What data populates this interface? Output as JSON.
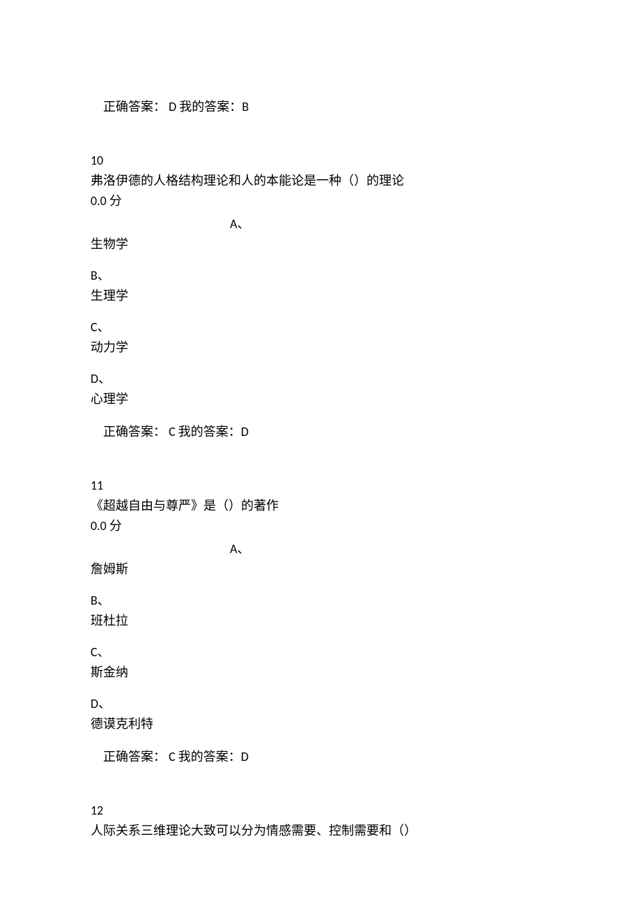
{
  "q9_answer": {
    "correct_label": "正确答案：",
    "correct_value": " D ",
    "my_label": "  我的答案：",
    "my_value": "B"
  },
  "q10": {
    "number": "10",
    "stem": "弗洛伊德的人格结构理论和人的本能论是一种（）的理论",
    "score": "0.0 分",
    "opts": {
      "a_label": "A、",
      "a_text": "生物学",
      "b_label": "B、",
      "b_text": "生理学",
      "c_label": "C、",
      "c_text": "动力学",
      "d_label": "D、",
      "d_text": "心理学"
    },
    "answer": {
      "correct_label": "正确答案：",
      "correct_value": " C ",
      "my_label": "  我的答案：",
      "my_value": "D"
    }
  },
  "q11": {
    "number": "11",
    "stem": "《超越自由与尊严》是（）的著作",
    "score": "0.0 分",
    "opts": {
      "a_label": "A、",
      "a_text": "詹姆斯",
      "b_label": "B、",
      "b_text": "班杜拉",
      "c_label": "C、",
      "c_text": "斯金纳",
      "d_label": "D、",
      "d_text": "德谟克利特"
    },
    "answer": {
      "correct_label": "正确答案：",
      "correct_value": " C ",
      "my_label": "  我的答案：",
      "my_value": "D"
    }
  },
  "q12": {
    "number": "12",
    "stem": "人际关系三维理论大致可以分为情感需要、控制需要和（）"
  }
}
